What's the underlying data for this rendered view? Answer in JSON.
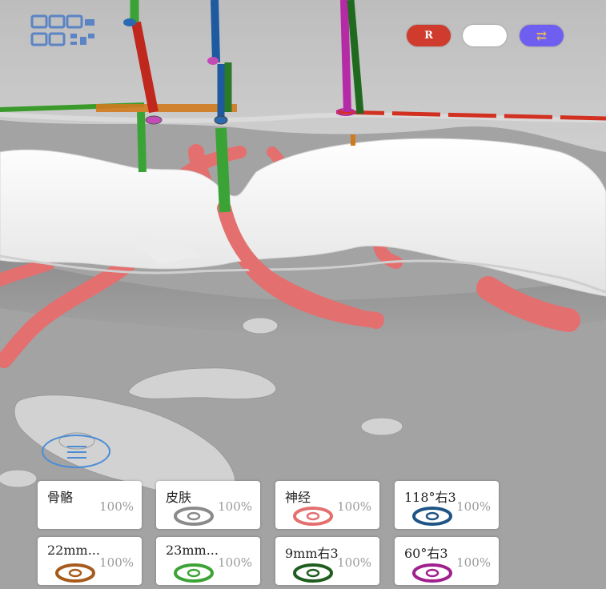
{
  "top_bar": {
    "r_button_label": "R",
    "swap_button_label": "⇄",
    "qr_icon": "qr-code-icon"
  },
  "menu": {
    "icon": "menu-icon"
  },
  "layers": [
    {
      "label": "骨骼",
      "opacity": "100%",
      "color": "",
      "eye": false
    },
    {
      "label": "皮肤",
      "opacity": "100%",
      "color": "#8a8a8a",
      "eye": true
    },
    {
      "label": "神经",
      "opacity": "100%",
      "color": "#e46f6f",
      "eye": true
    },
    {
      "label": "118°右3",
      "opacity": "100%",
      "color": "#1f5585",
      "eye": true
    },
    {
      "label": "22mm...",
      "opacity": "100%",
      "color": "#a65b1c",
      "eye": true
    },
    {
      "label": "23mm...",
      "opacity": "100%",
      "color": "#3ea336",
      "eye": true
    },
    {
      "label": "9mm右3",
      "opacity": "100%",
      "color": "#1f5d1f",
      "eye": true
    },
    {
      "label": "60°右3",
      "opacity": "100%",
      "color": "#a0218e",
      "eye": true
    }
  ],
  "colors": {
    "background": "#a3a3a3",
    "bone": "#f4f4f4",
    "nerve": "#e46f6f",
    "accent_blue": "#4a8cd6"
  }
}
